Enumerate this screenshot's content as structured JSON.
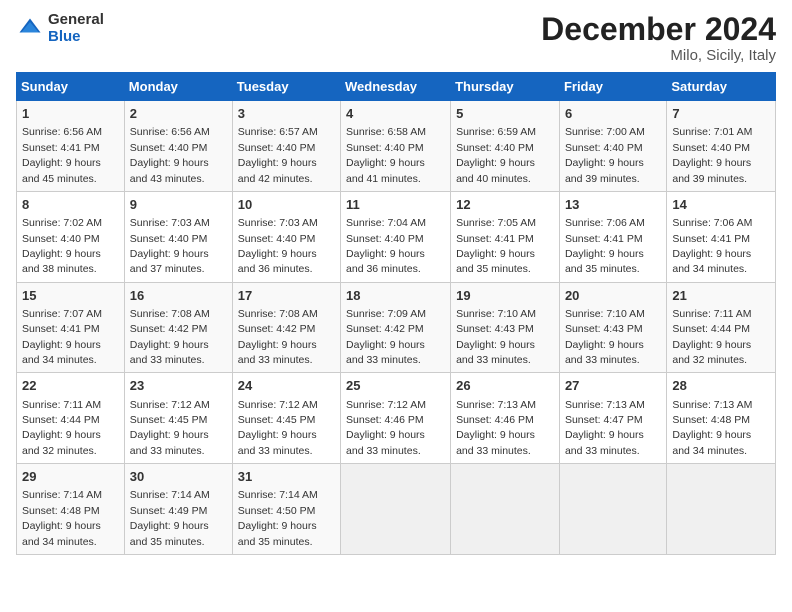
{
  "logo": {
    "general": "General",
    "blue": "Blue"
  },
  "title": "December 2024",
  "location": "Milo, Sicily, Italy",
  "days_header": [
    "Sunday",
    "Monday",
    "Tuesday",
    "Wednesday",
    "Thursday",
    "Friday",
    "Saturday"
  ],
  "weeks": [
    [
      {
        "day": "1",
        "sunrise": "6:56 AM",
        "sunset": "4:41 PM",
        "daylight": "9 hours and 45 minutes."
      },
      {
        "day": "2",
        "sunrise": "6:56 AM",
        "sunset": "4:40 PM",
        "daylight": "9 hours and 43 minutes."
      },
      {
        "day": "3",
        "sunrise": "6:57 AM",
        "sunset": "4:40 PM",
        "daylight": "9 hours and 42 minutes."
      },
      {
        "day": "4",
        "sunrise": "6:58 AM",
        "sunset": "4:40 PM",
        "daylight": "9 hours and 41 minutes."
      },
      {
        "day": "5",
        "sunrise": "6:59 AM",
        "sunset": "4:40 PM",
        "daylight": "9 hours and 40 minutes."
      },
      {
        "day": "6",
        "sunrise": "7:00 AM",
        "sunset": "4:40 PM",
        "daylight": "9 hours and 39 minutes."
      },
      {
        "day": "7",
        "sunrise": "7:01 AM",
        "sunset": "4:40 PM",
        "daylight": "9 hours and 39 minutes."
      }
    ],
    [
      {
        "day": "8",
        "sunrise": "7:02 AM",
        "sunset": "4:40 PM",
        "daylight": "9 hours and 38 minutes."
      },
      {
        "day": "9",
        "sunrise": "7:03 AM",
        "sunset": "4:40 PM",
        "daylight": "9 hours and 37 minutes."
      },
      {
        "day": "10",
        "sunrise": "7:03 AM",
        "sunset": "4:40 PM",
        "daylight": "9 hours and 36 minutes."
      },
      {
        "day": "11",
        "sunrise": "7:04 AM",
        "sunset": "4:40 PM",
        "daylight": "9 hours and 36 minutes."
      },
      {
        "day": "12",
        "sunrise": "7:05 AM",
        "sunset": "4:41 PM",
        "daylight": "9 hours and 35 minutes."
      },
      {
        "day": "13",
        "sunrise": "7:06 AM",
        "sunset": "4:41 PM",
        "daylight": "9 hours and 35 minutes."
      },
      {
        "day": "14",
        "sunrise": "7:06 AM",
        "sunset": "4:41 PM",
        "daylight": "9 hours and 34 minutes."
      }
    ],
    [
      {
        "day": "15",
        "sunrise": "7:07 AM",
        "sunset": "4:41 PM",
        "daylight": "9 hours and 34 minutes."
      },
      {
        "day": "16",
        "sunrise": "7:08 AM",
        "sunset": "4:42 PM",
        "daylight": "9 hours and 33 minutes."
      },
      {
        "day": "17",
        "sunrise": "7:08 AM",
        "sunset": "4:42 PM",
        "daylight": "9 hours and 33 minutes."
      },
      {
        "day": "18",
        "sunrise": "7:09 AM",
        "sunset": "4:42 PM",
        "daylight": "9 hours and 33 minutes."
      },
      {
        "day": "19",
        "sunrise": "7:10 AM",
        "sunset": "4:43 PM",
        "daylight": "9 hours and 33 minutes."
      },
      {
        "day": "20",
        "sunrise": "7:10 AM",
        "sunset": "4:43 PM",
        "daylight": "9 hours and 33 minutes."
      },
      {
        "day": "21",
        "sunrise": "7:11 AM",
        "sunset": "4:44 PM",
        "daylight": "9 hours and 32 minutes."
      }
    ],
    [
      {
        "day": "22",
        "sunrise": "7:11 AM",
        "sunset": "4:44 PM",
        "daylight": "9 hours and 32 minutes."
      },
      {
        "day": "23",
        "sunrise": "7:12 AM",
        "sunset": "4:45 PM",
        "daylight": "9 hours and 33 minutes."
      },
      {
        "day": "24",
        "sunrise": "7:12 AM",
        "sunset": "4:45 PM",
        "daylight": "9 hours and 33 minutes."
      },
      {
        "day": "25",
        "sunrise": "7:12 AM",
        "sunset": "4:46 PM",
        "daylight": "9 hours and 33 minutes."
      },
      {
        "day": "26",
        "sunrise": "7:13 AM",
        "sunset": "4:46 PM",
        "daylight": "9 hours and 33 minutes."
      },
      {
        "day": "27",
        "sunrise": "7:13 AM",
        "sunset": "4:47 PM",
        "daylight": "9 hours and 33 minutes."
      },
      {
        "day": "28",
        "sunrise": "7:13 AM",
        "sunset": "4:48 PM",
        "daylight": "9 hours and 34 minutes."
      }
    ],
    [
      {
        "day": "29",
        "sunrise": "7:14 AM",
        "sunset": "4:48 PM",
        "daylight": "9 hours and 34 minutes."
      },
      {
        "day": "30",
        "sunrise": "7:14 AM",
        "sunset": "4:49 PM",
        "daylight": "9 hours and 35 minutes."
      },
      {
        "day": "31",
        "sunrise": "7:14 AM",
        "sunset": "4:50 PM",
        "daylight": "9 hours and 35 minutes."
      },
      null,
      null,
      null,
      null
    ]
  ]
}
